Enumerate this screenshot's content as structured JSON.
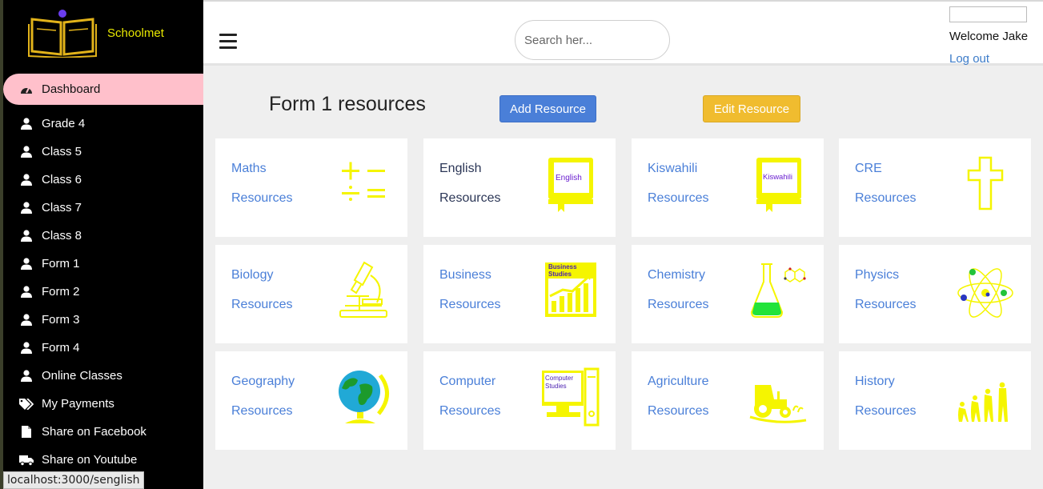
{
  "brand": {
    "name": "Schoolmet"
  },
  "sidebar": {
    "items": [
      {
        "label": "Dashboard",
        "icon": "tachometer-icon"
      },
      {
        "label": "Grade 4",
        "icon": "user-icon"
      },
      {
        "label": "Class 5",
        "icon": "user-icon"
      },
      {
        "label": "Class 6",
        "icon": "user-icon"
      },
      {
        "label": "Class 7",
        "icon": "user-icon"
      },
      {
        "label": "Class 8",
        "icon": "user-icon"
      },
      {
        "label": "Form 1",
        "icon": "user-icon"
      },
      {
        "label": "Form 2",
        "icon": "user-icon"
      },
      {
        "label": "Form 3",
        "icon": "user-icon"
      },
      {
        "label": "Form 4",
        "icon": "user-icon"
      },
      {
        "label": "Online Classes",
        "icon": "user-icon"
      },
      {
        "label": "My Payments",
        "icon": "tags-icon"
      },
      {
        "label": "Share on Facebook",
        "icon": "file-icon"
      },
      {
        "label": "Share on Youtube",
        "icon": "truck-icon"
      }
    ]
  },
  "header": {
    "search_placeholder": "Search her...",
    "welcome": "Welcome Jake",
    "logout": "Log out"
  },
  "main": {
    "title": "Form 1 resources",
    "add_button": "Add Resource",
    "edit_button": "Edit Resource",
    "cards": [
      {
        "subject": "Maths",
        "sub": "Resources",
        "icon": "math-operators-icon"
      },
      {
        "subject": "English",
        "sub": "Resources",
        "icon": "english-book-icon",
        "book_text": "English"
      },
      {
        "subject": "Kiswahili",
        "sub": "Resources",
        "icon": "kiswahili-book-icon",
        "book_text": "Kiswahili"
      },
      {
        "subject": "CRE",
        "sub": "Resources",
        "icon": "cross-icon"
      },
      {
        "subject": "Biology",
        "sub": "Resources",
        "icon": "microscope-icon"
      },
      {
        "subject": "Business",
        "sub": "Resources",
        "icon": "business-chart-icon",
        "chart_text_1": "Business",
        "chart_text_2": "Studies"
      },
      {
        "subject": "Chemistry",
        "sub": "Resources",
        "icon": "flask-icon"
      },
      {
        "subject": "Physics",
        "sub": "Resources",
        "icon": "atom-icon"
      },
      {
        "subject": "Geography",
        "sub": "Resources",
        "icon": "globe-icon"
      },
      {
        "subject": "Computer",
        "sub": "Resources",
        "icon": "computer-icon",
        "screen_text_1": "Computer",
        "screen_text_2": "Studies"
      },
      {
        "subject": "Agriculture",
        "sub": "Resources",
        "icon": "tractor-icon"
      },
      {
        "subject": "History",
        "sub": "Resources",
        "icon": "evolution-icon"
      }
    ]
  },
  "status_bar": {
    "url": "localhost:3000/senglish"
  },
  "colors": {
    "sidebar_bg": "#000000",
    "active_item": "#ffc0cb",
    "accent_blue": "#4a7fd8",
    "accent_yellow": "#f0bc2f",
    "icon_yellow": "#f5f500"
  }
}
